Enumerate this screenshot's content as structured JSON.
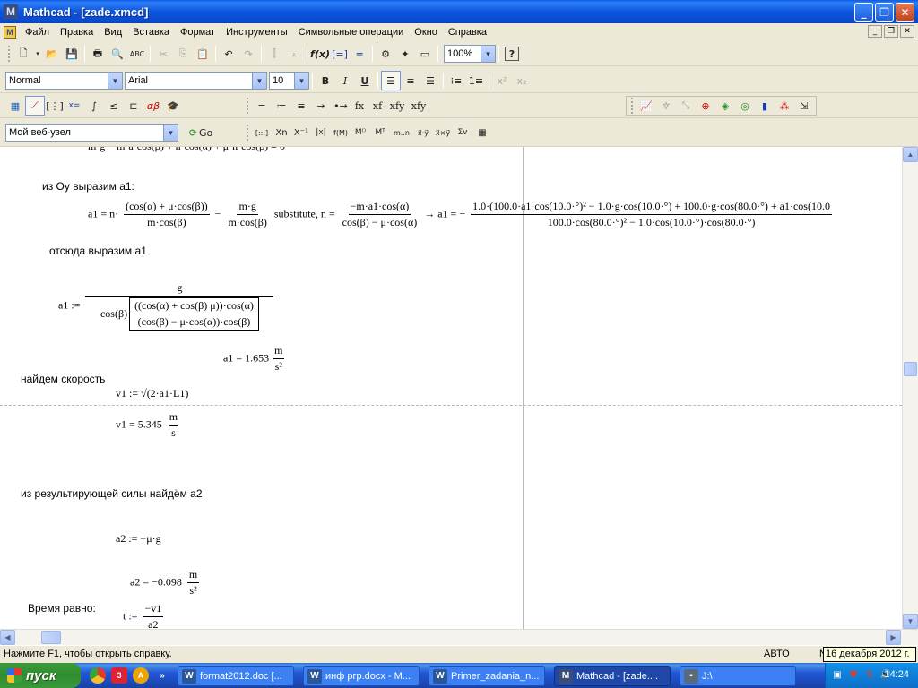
{
  "window": {
    "app_icon": "M",
    "title": "Mathcad - [zade.xmcd]",
    "controls": [
      "_",
      "❐",
      "✕"
    ]
  },
  "menu": {
    "items": [
      "Файл",
      "Правка",
      "Вид",
      "Вставка",
      "Формат",
      "Инструменты",
      "Символьные операции",
      "Окно",
      "Справка"
    ],
    "mdi_controls": [
      "_",
      "❐",
      "✕"
    ]
  },
  "toolbar_standard": {
    "zoom_value": "100%"
  },
  "toolbar_format": {
    "style_value": "Normal",
    "font_value": "Arial",
    "size_value": "10",
    "bold": "B",
    "italic": "I",
    "underline": "U"
  },
  "toolbar_web": {
    "address_value": "Мой веб-узел",
    "go_label": "Go"
  },
  "toolbar_symbolic": {
    "buttons": [
      "=",
      "≔",
      "≡",
      "→",
      "•→",
      "fx",
      "xf",
      "xfy",
      "xfy"
    ]
  },
  "toolbar_matrix": {
    "buttons": [
      "[:::]",
      "Xn",
      "X⁻¹",
      "|x|",
      "f(M)",
      "M⁽⁾",
      "Mᵀ",
      "m..n",
      "x⃗·y⃗",
      "x⃗×y⃗",
      "Σv",
      "▦"
    ]
  },
  "document": {
    "text_oy": "из Оу выразим а1:",
    "eq1": {
      "lhs": "a1 = n·",
      "num1": "(cos(α) + μ·cos(β))",
      "den1": "m·cos(β)",
      "minus": "−",
      "num2": "m·g",
      "den2": "m·cos(β)",
      "substitute": "substitute, n =",
      "num3": "−m·a1·cos(α)",
      "den3": "cos(β) − μ·cos(α)",
      "arrow": "→ a1 = −",
      "rnum": "1.0·(100.0·a1·cos(10.0·°)² − 1.0·g·cos(10.0·°) + 100.0·g·cos(80.0·°) + a1·cos(10.0",
      "rden": "100.0·cos(80.0·°)² − 1.0·cos(10.0·°)·cos(80.0·°)"
    },
    "text_express": "отсюда выразим а1",
    "eq2": {
      "lhs": "a1 :=",
      "num": "g",
      "den_prefix": "cos(β)",
      "inner_num": "((cos(α) + cos(β) μ))·cos(α)",
      "inner_den": "(cos(β) − μ·cos(α))·cos(β)"
    },
    "a1_result": {
      "lhs": "a1 = 1.653",
      "unit_num": "m",
      "unit_den": "s²"
    },
    "text_speed": "найдем скорость",
    "v1_def": "v1 := √(2·a1·L1)",
    "v1_result": {
      "lhs": "v1 = 5.345",
      "unit_num": "m",
      "unit_den": "s"
    },
    "text_force": "из результирующей силы найдём а2",
    "a2_def": "a2 := −μ·g",
    "a2_result": {
      "lhs": "a2 = −0.098",
      "unit_num": "m",
      "unit_den": "s²"
    },
    "text_time": "Время равно:",
    "t_def": {
      "lhs": "t :=",
      "num": "−v1",
      "den": "a2"
    }
  },
  "statusbar": {
    "help": "Нажмите F1, чтобы открыть справку.",
    "mode": "АВТО",
    "num": "N",
    "tooltip": "16 декабря 2012 г."
  },
  "taskbar": {
    "start_label": "пуск",
    "tasks": [
      {
        "label": "format2012.doc [...",
        "icon": "W"
      },
      {
        "label": "инф ргр.docx - M...",
        "icon": "W"
      },
      {
        "label": "Primer_zadania_n...",
        "icon": "W"
      },
      {
        "label": "Mathcad - [zade....",
        "icon": "M"
      },
      {
        "label": "J:\\",
        "icon": "▪"
      }
    ],
    "clock": "14:24"
  }
}
